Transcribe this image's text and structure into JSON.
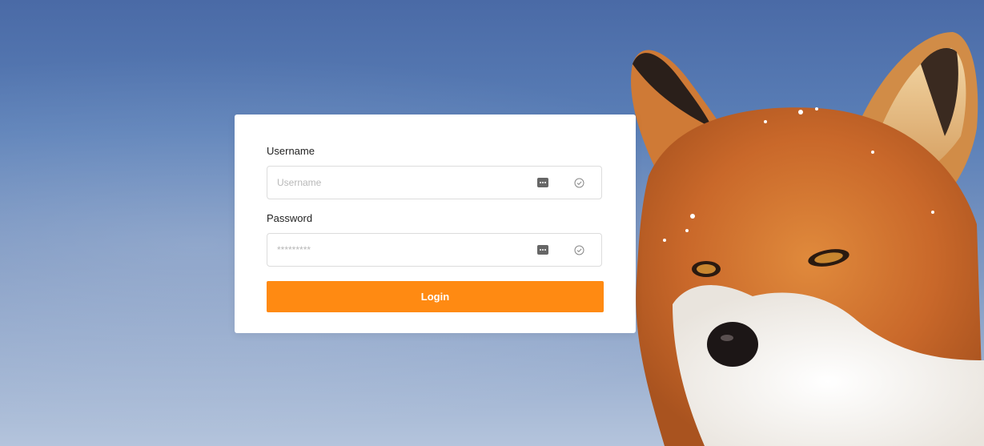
{
  "form": {
    "username_label": "Username",
    "username_placeholder": "Username",
    "password_label": "Password",
    "password_placeholder": "*********",
    "login_label": "Login"
  },
  "icons": {
    "field_menu": "password-manager-icon",
    "field_check": "check-circle-icon"
  },
  "colors": {
    "accent": "#ff8a12",
    "background": "#5b80b8"
  }
}
